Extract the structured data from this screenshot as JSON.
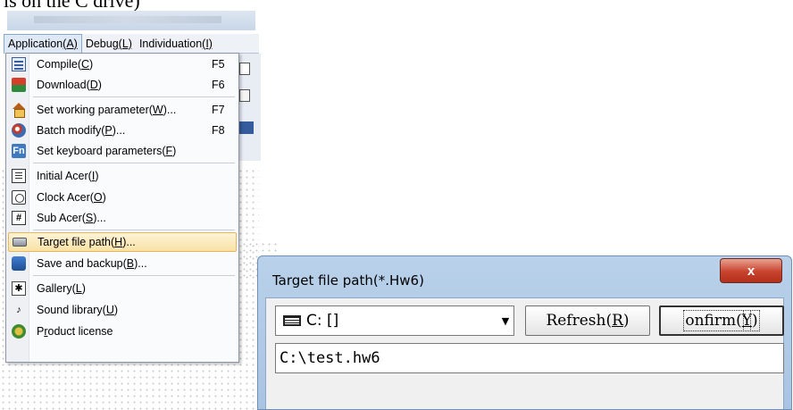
{
  "caption": "is on the C drive)",
  "menubar": {
    "items": [
      {
        "label": "Application",
        "hotkey": "(A)"
      },
      {
        "label": "Debug",
        "hotkey": "(L)"
      },
      {
        "label": "Individuation",
        "hotkey": "(I)"
      }
    ]
  },
  "dropdown": {
    "items": [
      {
        "pre": "Compile(",
        "key": "C",
        "post": ")",
        "shortcut": "F5",
        "icon": "compile-icon"
      },
      {
        "pre": "Download(",
        "key": "D",
        "post": ")",
        "shortcut": "F6",
        "icon": "download-icon"
      },
      {
        "pre": "Set working parameter(",
        "key": "W",
        "post": ")...",
        "shortcut": "F7",
        "icon": "house-icon"
      },
      {
        "pre": "Batch modify(",
        "key": "P",
        "post": ")...",
        "shortcut": "F8",
        "icon": "batch-icon"
      },
      {
        "pre": "Set keyboard parameters(",
        "key": "F",
        "post": ")",
        "shortcut": "",
        "icon": "fn-icon"
      },
      {
        "pre": "Initial Acer(",
        "key": "I",
        "post": ")",
        "shortcut": "",
        "icon": "document-icon"
      },
      {
        "pre": "Clock Acer(",
        "key": "O",
        "post": ")",
        "shortcut": "",
        "icon": "clock-icon"
      },
      {
        "pre": "Sub Acer(",
        "key": "S",
        "post": ")...",
        "shortcut": "",
        "icon": "hash-icon"
      },
      {
        "pre": "Target file path(",
        "key": "H",
        "post": ")...",
        "shortcut": "",
        "icon": "drive-icon"
      },
      {
        "pre": "Save and backup(",
        "key": "B",
        "post": ")...",
        "shortcut": "",
        "icon": "save-icon"
      },
      {
        "pre": "Gallery(",
        "key": "L",
        "post": ")",
        "shortcut": "",
        "icon": "gallery-icon"
      },
      {
        "pre": "Sound library(",
        "key": "U",
        "post": ")",
        "shortcut": "",
        "icon": "music-note-icon"
      },
      {
        "pre": "P",
        "key": "r",
        "post": "oduct license",
        "shortcut": "",
        "icon": "license-icon"
      }
    ]
  },
  "dialog": {
    "title": "Target file path(*.Hw6)",
    "close_symbol": "x",
    "drive_value": "C: []",
    "dropdown_arrow": "▼",
    "refresh": {
      "pre": "Refresh(",
      "key": "R",
      "post": ")"
    },
    "confirm": {
      "pre": "onfirm(",
      "key": "Y",
      "post": ")"
    },
    "path_value": "C:\\test.hw6"
  },
  "colors": {
    "menu_highlight": "#f9e2a6",
    "dialog_frame": "#b9d1ea",
    "close_button": "#c8432c"
  }
}
